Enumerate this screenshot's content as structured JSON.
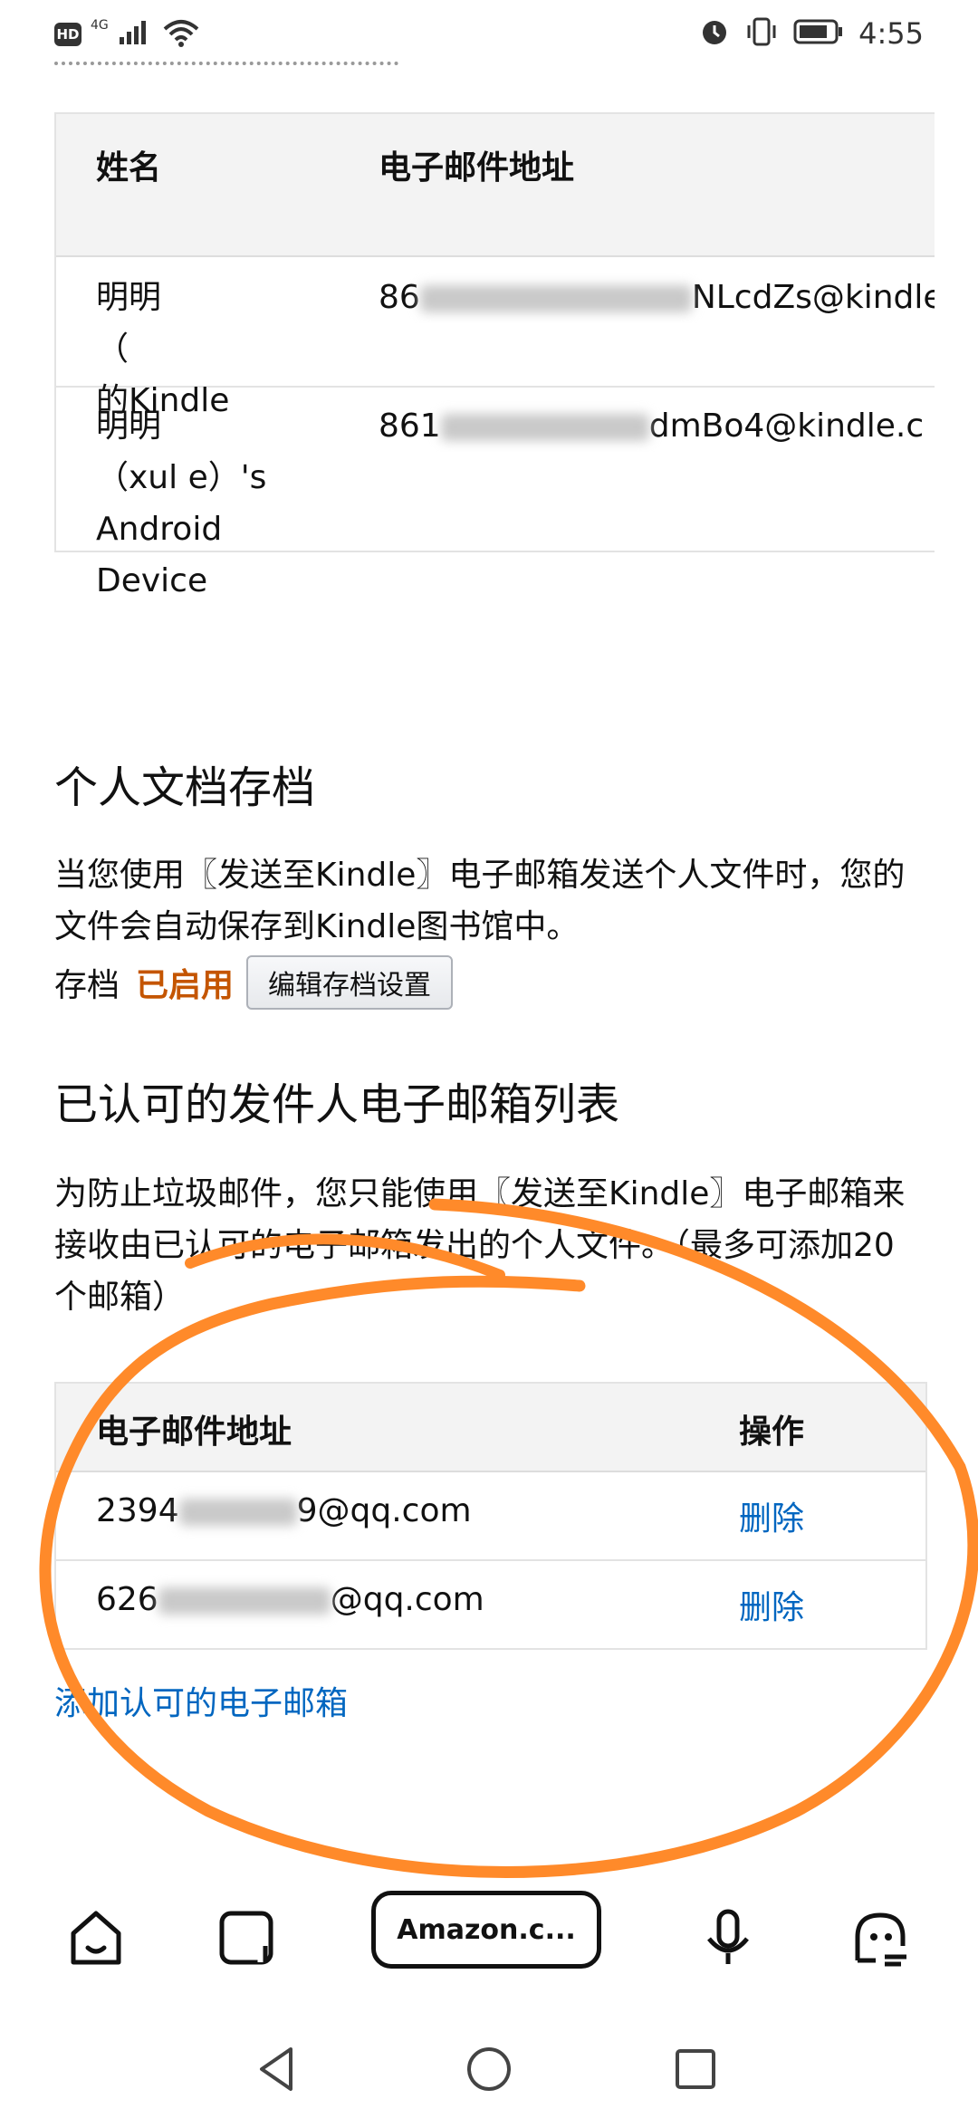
{
  "status_bar": {
    "hd_badge": "HD",
    "network": "4G",
    "time": "4:55",
    "icons": [
      "signal-icon",
      "wifi-icon",
      "alarm-icon",
      "vibrate-icon",
      "battery-icon"
    ]
  },
  "devices_table": {
    "headers": {
      "name": "姓名",
      "email": "电子邮件地址"
    },
    "rows": [
      {
        "name": "明明\n（        \n的Kindle",
        "email_prefix": "86",
        "email_suffix": "NLcdZs@kindle.c"
      },
      {
        "name": "明明\n（xul     e）'s\nAndroid\nDevice",
        "email_prefix": "861",
        "email_suffix": "dmBo4@kindle.c"
      }
    ]
  },
  "archive": {
    "title": "个人文档存档",
    "description": "当您使用〖发送至Kindle〗电子邮箱发送个人文件时，您的文件会自动保存到Kindle图书馆中。",
    "label": "存档",
    "status": "已启用",
    "edit_button": "编辑存档设置"
  },
  "approved": {
    "title": "已认可的发件人电子邮箱列表",
    "description": "为防止垃圾邮件，您只能使用〖发送至Kindle〗电子邮箱来接收由已认可的电子邮箱发出的个人文件。（最多可添加20个邮箱）",
    "headers": {
      "email": "电子邮件地址",
      "action": "操作"
    },
    "rows": [
      {
        "email_prefix": "2394",
        "email_suffix": "9@qq.com",
        "action": "删除"
      },
      {
        "email_prefix": "626",
        "email_suffix": "@qq.com",
        "action": "删除"
      }
    ],
    "add_link": "添加认可的电子邮箱"
  },
  "browser_bar": {
    "url": "Amazon.c...",
    "icons": [
      "home-icon",
      "tabs-icon",
      "microphone-icon",
      "assistant-icon"
    ]
  },
  "nav_bar": {
    "icons": [
      "back-icon",
      "home-circle-icon",
      "recents-icon"
    ]
  },
  "colors": {
    "link": "#0066c0",
    "enabled": "#c45500",
    "annotation": "#ff8a2a"
  }
}
